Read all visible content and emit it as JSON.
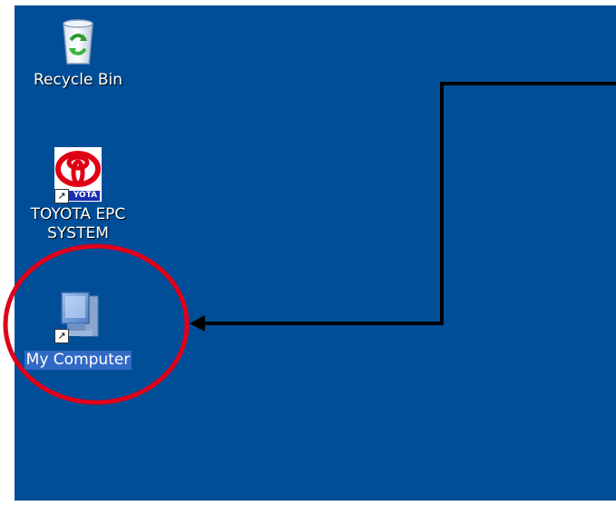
{
  "desktop": {
    "background_color": "#004e98",
    "icons": [
      {
        "label": "Recycle Bin",
        "icon": "recycle-bin-icon"
      },
      {
        "label": "TOYOTA EPC SYSTEM",
        "line1": "TOYOTA EPC",
        "line2": "SYSTEM",
        "icon": "toyota-logo-icon",
        "badge_text": "YOTA",
        "shortcut": true
      },
      {
        "label": "My Computer",
        "icon": "computer-icon",
        "shortcut": true,
        "selected": true
      }
    ]
  },
  "annotation": {
    "highlight": "red-circle",
    "pointer": "black-arrow",
    "circle_color": "#e0001a",
    "arrow_color": "#000000"
  }
}
